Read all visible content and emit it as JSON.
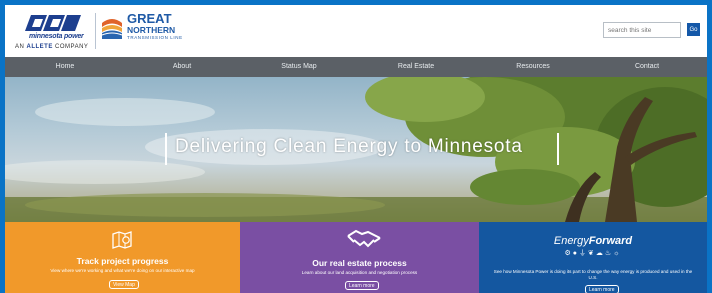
{
  "header": {
    "mp_logo_name": "minnesota power",
    "allete_prefix": "AN",
    "allete_name": "ALLETE",
    "allete_suffix": "COMPANY",
    "gn_title": "GREAT",
    "gn_sub": "NORTHERN",
    "gn_tag": "TRANSMISSION LINE",
    "search_placeholder": "search this site",
    "go_label": "Go"
  },
  "nav": {
    "items": [
      {
        "label": "Home"
      },
      {
        "label": "About"
      },
      {
        "label": "Status Map"
      },
      {
        "label": "Real Estate"
      },
      {
        "label": "Resources"
      },
      {
        "label": "Contact"
      }
    ]
  },
  "hero": {
    "title": "Delivering Clean Energy to Minnesota"
  },
  "panels": {
    "track": {
      "title": "Track project progress",
      "desc": "View where we're working and what we're doing on our interactive map",
      "button": "View Map",
      "color": "#f1992a"
    },
    "real_estate": {
      "title": "Our real estate process",
      "desc": "Learn about our land acquisition and negotiation process",
      "button": "Learn more",
      "color": "#7a4fa3"
    },
    "energy": {
      "title_a": "Energy",
      "title_b": "Forward",
      "desc": "See how Minnesota Power is doing its part to change the way energy is produced and used in the U.S.",
      "button": "Learn more",
      "color": "#1457a0"
    }
  },
  "colors": {
    "frame_border": "#0a73c6",
    "nav_bg": "#5b6066",
    "brand_blue": "#1d3f8f"
  }
}
